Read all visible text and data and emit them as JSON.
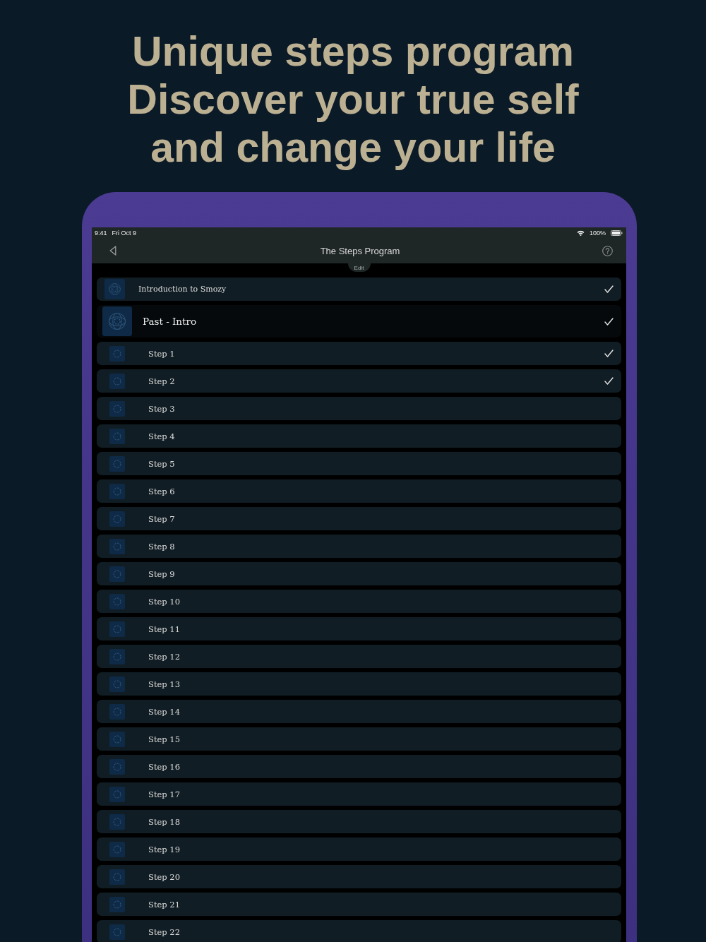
{
  "headline": [
    "Unique steps program",
    "Discover your true self",
    "and change your life"
  ],
  "status_bar": {
    "time": "9:41",
    "date": "Fri Oct 9",
    "battery": "100%"
  },
  "nav": {
    "title": "The Steps Program",
    "edit": "Edit"
  },
  "items": [
    {
      "kind": "intro",
      "label": "Introduction to Smozy",
      "checked": true
    },
    {
      "kind": "section",
      "label": "Past - Intro",
      "checked": true
    },
    {
      "kind": "step",
      "label": "Step 1",
      "checked": true
    },
    {
      "kind": "step",
      "label": "Step 2",
      "checked": true
    },
    {
      "kind": "step",
      "label": "Step 3",
      "checked": false
    },
    {
      "kind": "step",
      "label": "Step 4",
      "checked": false
    },
    {
      "kind": "step",
      "label": "Step 5",
      "checked": false
    },
    {
      "kind": "step",
      "label": "Step 6",
      "checked": false
    },
    {
      "kind": "step",
      "label": "Step 7",
      "checked": false
    },
    {
      "kind": "step",
      "label": "Step 8",
      "checked": false
    },
    {
      "kind": "step",
      "label": "Step 9",
      "checked": false
    },
    {
      "kind": "step",
      "label": "Step 10",
      "checked": false
    },
    {
      "kind": "step",
      "label": "Step 11",
      "checked": false
    },
    {
      "kind": "step",
      "label": "Step 12",
      "checked": false
    },
    {
      "kind": "step",
      "label": "Step 13",
      "checked": false
    },
    {
      "kind": "step",
      "label": "Step 14",
      "checked": false
    },
    {
      "kind": "step",
      "label": "Step 15",
      "checked": false
    },
    {
      "kind": "step",
      "label": "Step 16",
      "checked": false
    },
    {
      "kind": "step",
      "label": "Step 17",
      "checked": false
    },
    {
      "kind": "step",
      "label": "Step 18",
      "checked": false
    },
    {
      "kind": "step",
      "label": "Step 19",
      "checked": false
    },
    {
      "kind": "step",
      "label": "Step 20",
      "checked": false
    },
    {
      "kind": "step",
      "label": "Step 21",
      "checked": false
    },
    {
      "kind": "step",
      "label": "Step 22",
      "checked": false
    }
  ]
}
